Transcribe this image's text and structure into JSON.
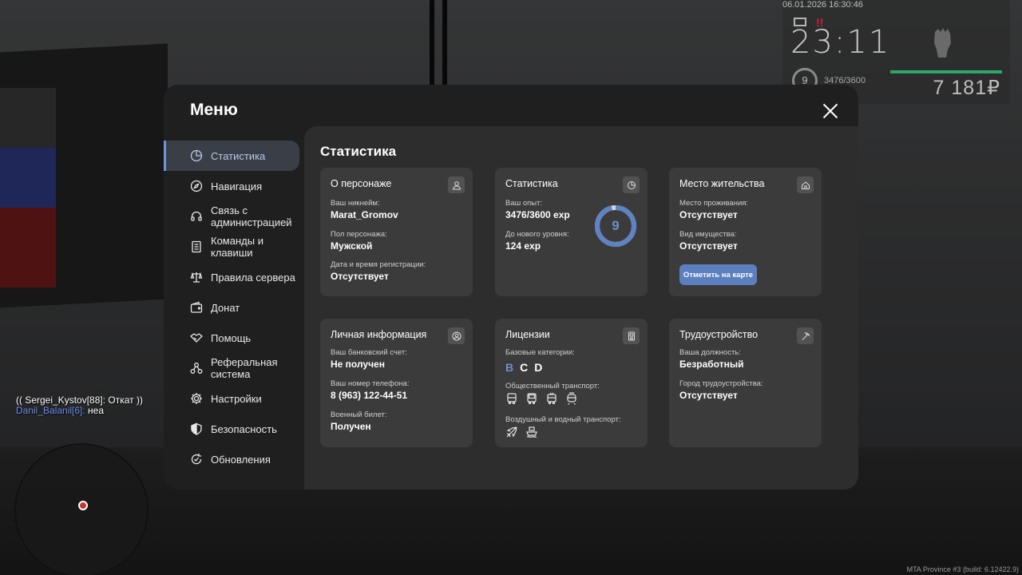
{
  "hud": {
    "datetime": "06.01.2026 16:30:46",
    "time": "23:11",
    "level": "9",
    "exp": "3476/3600",
    "money": "7 181₽",
    "icons": [
      "mail-icon",
      "alert-icon",
      "fist-icon"
    ]
  },
  "chat": {
    "line1": "(( Sergei_Kystov[88]: Откат ))",
    "line2_name": "Danil_Balanil[6]:",
    "line2_text": " неа"
  },
  "build": "MTA Province #3 (build: 6.12422.9)",
  "menu": {
    "title": "Меню",
    "accent_color": "#6f93d6",
    "sidebar": [
      {
        "label": "Статистика",
        "icon": "pie-chart-icon",
        "active": true
      },
      {
        "label": "Навигация",
        "icon": "compass-icon"
      },
      {
        "label": "Связь с администрацией",
        "icon": "headset-icon"
      },
      {
        "label": "Команды и клавиши",
        "icon": "document-icon"
      },
      {
        "label": "Правила сервера",
        "icon": "scales-icon"
      },
      {
        "label": "Донат",
        "icon": "wallet-icon"
      },
      {
        "label": "Помощь",
        "icon": "handshake-icon"
      },
      {
        "label": "Реферальная система",
        "icon": "network-icon"
      },
      {
        "label": "Настройки",
        "icon": "gear-icon"
      },
      {
        "label": "Безопасность",
        "icon": "shield-icon"
      },
      {
        "label": "Обновления",
        "icon": "refresh-icon"
      }
    ],
    "content_title": "Статистика",
    "cards": {
      "character": {
        "title": "О персонаже",
        "icon": "user-icon",
        "nickname_label": "Ваш никнейм:",
        "nickname": "Marat_Gromov",
        "gender_label": "Пол персонажа:",
        "gender": "Мужской",
        "reg_label": "Дата и время регистрации:",
        "reg": "Отсутствует"
      },
      "stats": {
        "title": "Статистика",
        "icon": "pie-chart-icon",
        "exp_label": "Ваш опыт:",
        "exp": "3476/3600 exp",
        "next_label": "До нового уровня:",
        "next": "124 exp",
        "level": "9",
        "progress": 0.9656
      },
      "residence": {
        "title": "Место жительства",
        "icon": "home-icon",
        "place_label": "Место проживания:",
        "place": "Отсутствует",
        "property_label": "Вид имущества:",
        "property": "Отсутствует",
        "map_button": "Отметить на карте"
      },
      "personal": {
        "title": "Личная информация",
        "icon": "user-circle-icon",
        "bank_label": "Ваш банковский счет:",
        "bank": "Не получен",
        "phone_label": "Ваш номер телефона:",
        "phone": "8 (963) 122-44-51",
        "military_label": "Военный билет:",
        "military": "Получен"
      },
      "licenses": {
        "title": "Лицензии",
        "icon": "id-card-icon",
        "base_label": "Базовые категории:",
        "categories": [
          "B",
          "C",
          "D"
        ],
        "public_label": "Общественный транспорт:",
        "public_icons": [
          "bus-icon",
          "bus-icon",
          "trolleybus-icon",
          "tram-icon"
        ],
        "air_label": "Воздушный и водный транспорт:",
        "air_icons": [
          "plane-icon",
          "ship-icon"
        ]
      },
      "employment": {
        "title": "Трудоустройство",
        "icon": "pickaxe-icon",
        "position_label": "Ваша должность:",
        "position": "Безработный",
        "city_label": "Город трудоустройства:",
        "city": "Отсутствует"
      }
    }
  }
}
